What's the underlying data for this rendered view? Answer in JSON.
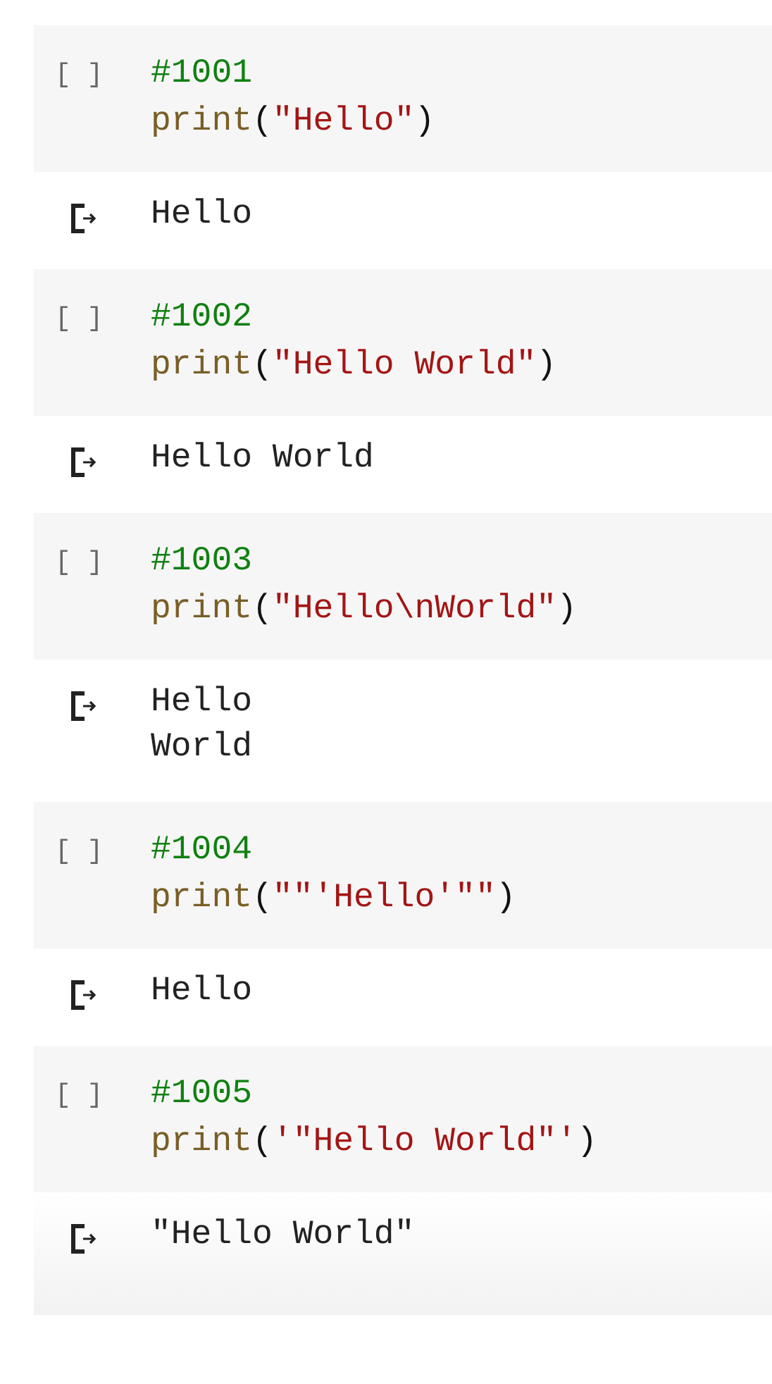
{
  "cells": [
    {
      "run_marker": "[ ]",
      "comment": "#1001",
      "code": [
        {
          "kind": "func",
          "text": "print"
        },
        {
          "kind": "punct",
          "text": "("
        },
        {
          "kind": "string",
          "text": "\"Hello\""
        },
        {
          "kind": "punct",
          "text": ")"
        }
      ],
      "output": [
        "Hello"
      ]
    },
    {
      "run_marker": "[ ]",
      "comment": "#1002",
      "code": [
        {
          "kind": "func",
          "text": "print"
        },
        {
          "kind": "punct",
          "text": "("
        },
        {
          "kind": "string",
          "text": "\"Hello World\""
        },
        {
          "kind": "punct",
          "text": ")"
        }
      ],
      "output": [
        "Hello World"
      ]
    },
    {
      "run_marker": "[ ]",
      "comment": "#1003",
      "code": [
        {
          "kind": "func",
          "text": "print"
        },
        {
          "kind": "punct",
          "text": "("
        },
        {
          "kind": "string",
          "text": "\"Hello\\nWorld\""
        },
        {
          "kind": "punct",
          "text": ")"
        }
      ],
      "output": [
        "Hello",
        "World"
      ]
    },
    {
      "run_marker": "[ ]",
      "comment": "#1004",
      "code": [
        {
          "kind": "func",
          "text": "print"
        },
        {
          "kind": "punct",
          "text": "("
        },
        {
          "kind": "string",
          "text": "\"\"'Hello'\"\""
        },
        {
          "kind": "punct",
          "text": ")"
        }
      ],
      "output": [
        "Hello"
      ]
    },
    {
      "run_marker": "[ ]",
      "comment": "#1005",
      "code": [
        {
          "kind": "func",
          "text": "print"
        },
        {
          "kind": "punct",
          "text": "("
        },
        {
          "kind": "string",
          "text": "'\"Hello World\"'"
        },
        {
          "kind": "punct",
          "text": ")"
        }
      ],
      "output": [
        "\"Hello World\""
      ]
    }
  ]
}
